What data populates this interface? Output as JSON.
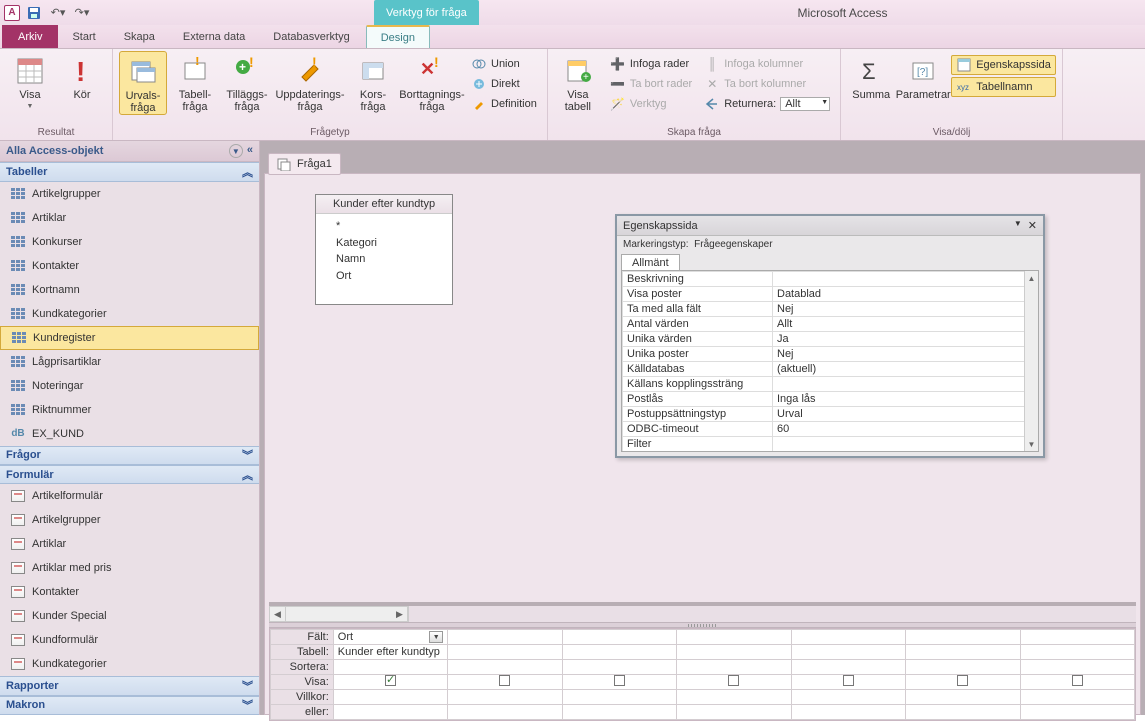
{
  "app": {
    "title": "Microsoft Access",
    "icon_letter": "A"
  },
  "context_tab": "Verktyg för fråga",
  "tabs": {
    "file": "Arkiv",
    "items": [
      "Start",
      "Skapa",
      "Externa data",
      "Databasverktyg"
    ],
    "active": "Design"
  },
  "ribbon": {
    "groups": {
      "resultat": {
        "label": "Resultat",
        "visa": "Visa",
        "kor": "Kör"
      },
      "fragetyp": {
        "label": "Frågetyp",
        "urval": "Urvals-\nfråga",
        "tabell": "Tabell-\nfråga",
        "tillagg": "Tilläggs-\nfråga",
        "uppdat": "Uppdaterings-\nfråga",
        "kors": "Kors-\nfråga",
        "borttag": "Borttagnings-\nfråga",
        "union": "Union",
        "direkt": "Direkt",
        "def": "Definition"
      },
      "skapa": {
        "label": "Skapa fråga",
        "visatabell": "Visa\ntabell",
        "infogarader": "Infoga rader",
        "tabortrader": "Ta bort rader",
        "verktyg": "Verktyg",
        "infogakol": "Infoga kolumner",
        "tabortkol": "Ta bort kolumner",
        "returnera_lbl": "Returnera:",
        "returnera_val": "Allt"
      },
      "visadolj": {
        "label": "Visa/dölj",
        "summa": "Summa",
        "param": "Parametrar",
        "egenskap": "Egenskapssida",
        "tabellnamn": "Tabellnamn"
      }
    }
  },
  "nav": {
    "header": "Alla Access-objekt",
    "groups": {
      "tabeller": {
        "label": "Tabeller",
        "items": [
          "Artikelgrupper",
          "Artiklar",
          "Konkurser",
          "Kontakter",
          "Kortnamn",
          "Kundkategorier",
          "Kundregister",
          "Lågprisartiklar",
          "Noteringar",
          "Riktnummer",
          "EX_KUND"
        ]
      },
      "fragor": {
        "label": "Frågor"
      },
      "formular": {
        "label": "Formulär",
        "items": [
          "Artikelformulär",
          "Artikelgrupper",
          "Artiklar",
          "Artiklar med pris",
          "Kontakter",
          "Kunder Special",
          "Kundformulär",
          "Kundkategorier"
        ]
      },
      "rapporter": {
        "label": "Rapporter"
      },
      "makron": {
        "label": "Makron"
      }
    }
  },
  "doc": {
    "tab": "Fråga1",
    "source": {
      "title": "Kunder efter kundtyp",
      "fields": [
        "*",
        "Kategori",
        "Namn",
        "Ort"
      ]
    }
  },
  "props": {
    "title": "Egenskapssida",
    "subtitle_lbl": "Markeringstyp:",
    "subtitle_val": "Frågeegenskaper",
    "tab": "Allmänt",
    "rows": [
      {
        "k": "Beskrivning",
        "v": ""
      },
      {
        "k": "Visa poster",
        "v": "Datablad"
      },
      {
        "k": "Ta med alla fält",
        "v": "Nej"
      },
      {
        "k": "Antal värden",
        "v": "Allt"
      },
      {
        "k": "Unika värden",
        "v": "Ja"
      },
      {
        "k": "Unika poster",
        "v": "Nej"
      },
      {
        "k": "Källdatabas",
        "v": "(aktuell)"
      },
      {
        "k": "Källans kopplingssträng",
        "v": ""
      },
      {
        "k": "Postlås",
        "v": "Inga lås"
      },
      {
        "k": "Postuppsättningstyp",
        "v": "Urval"
      },
      {
        "k": "ODBC-timeout",
        "v": "60"
      },
      {
        "k": "Filter",
        "v": ""
      }
    ]
  },
  "qbe": {
    "labels": {
      "falt": "Fält:",
      "tabell": "Tabell:",
      "sortera": "Sortera:",
      "visa": "Visa:",
      "villkor": "Villkor:",
      "eller": "eller:"
    },
    "col1": {
      "falt": "Ort",
      "tabell": "Kunder efter kundtyp",
      "visa": true
    }
  }
}
